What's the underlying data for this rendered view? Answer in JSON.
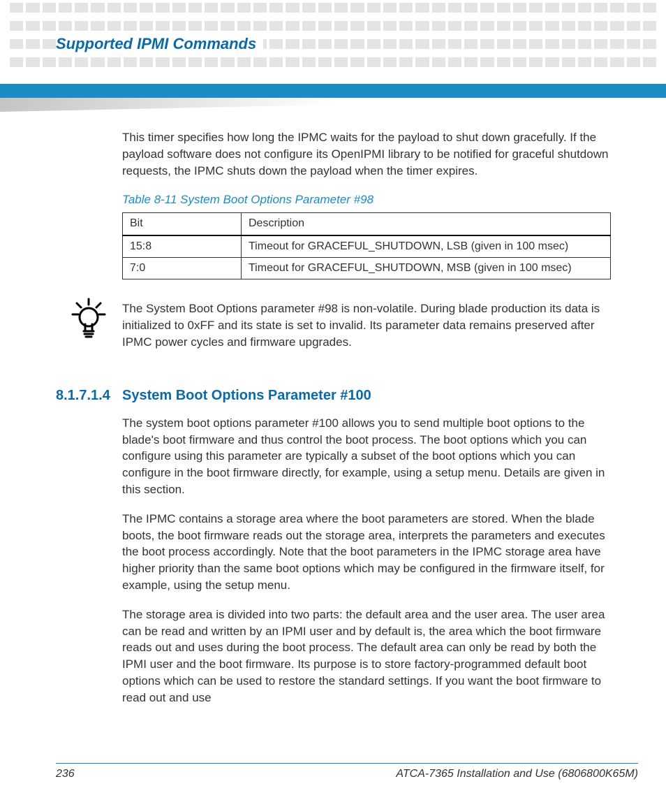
{
  "running_title": "Supported IPMI Commands",
  "paragraphs": {
    "intro": "This timer specifies how long the IPMC waits for the payload to shut down gracefully. If the payload software does not configure its OpenIPMI library to be notified for graceful shutdown requests, the IPMC shuts down the payload when the timer expires.",
    "tip": "The System Boot Options parameter #98 is non-volatile. During blade production its data is initialized to 0xFF and its state is set to invalid. Its parameter data remains preserved after IPMC power cycles and firmware upgrades.",
    "sec_p1": "The system boot options parameter #100 allows you to send multiple boot options to the blade's boot firmware and thus control the boot process. The boot options which you can configure using this parameter are typically a subset of the boot options which you can configure in the boot firmware directly, for example, using a setup menu. Details are given in this section.",
    "sec_p2": "The IPMC contains a storage area where the boot parameters are stored. When the blade boots, the boot firmware reads out the storage area, interprets the parameters and executes the boot process accordingly. Note that the boot parameters in the IPMC storage area have higher priority than the same boot options which may be configured in the firmware itself, for example, using the setup menu.",
    "sec_p3": "The storage area is divided into two parts: the default area and the user area. The user area can be read and written by an IPMI user and by default is, the area which the boot firmware reads out and uses during the boot process. The default area can only be read by both the IPMI user and the boot firmware. Its purpose is to store factory-programmed default boot options which can be used to restore the standard settings. If you want the boot firmware to read out and use"
  },
  "table": {
    "caption": "Table 8-11 System Boot Options Parameter #98",
    "headers": {
      "col1": "Bit",
      "col2": "Description"
    },
    "rows": [
      {
        "bit": "15:8",
        "desc": "Timeout for GRACEFUL_SHUTDOWN, LSB (given in 100 msec)"
      },
      {
        "bit": "7:0",
        "desc": "Timeout for GRACEFUL_SHUTDOWN, MSB (given in 100 msec)"
      }
    ]
  },
  "section": {
    "number": "8.1.7.1.4",
    "title": "System Boot Options Parameter #100"
  },
  "footer": {
    "page": "236",
    "doc": "ATCA-7365 Installation and Use (6806800K65M)"
  }
}
